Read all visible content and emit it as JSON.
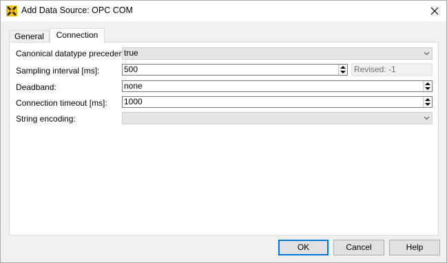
{
  "window": {
    "title": "Add Data Source: OPC COM"
  },
  "tabs": [
    {
      "label": "General"
    },
    {
      "label": "Connection"
    }
  ],
  "form": {
    "canonical": {
      "label": "Canonical datatype precedence:",
      "value": "true"
    },
    "sampling": {
      "label": "Sampling interval [ms]:",
      "value": "500",
      "revised": "Revised: -1"
    },
    "deadband": {
      "label": "Deadband:",
      "value": "none"
    },
    "timeout": {
      "label": "Connection timeout [ms]:",
      "value": "1000"
    },
    "encoding": {
      "label": "String encoding:",
      "value": ""
    }
  },
  "buttons": {
    "ok": "OK",
    "cancel": "Cancel",
    "help": "Help"
  },
  "colors": {
    "accent": "#0078d7",
    "icon_bg": "#f2c200"
  }
}
